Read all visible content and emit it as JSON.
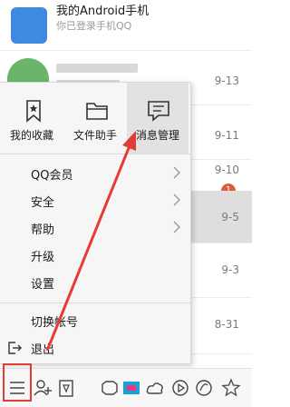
{
  "chat_list": {
    "rows": [
      {
        "title": "我的Android手机",
        "subtitle": "你已登录手机QQ",
        "date": ""
      },
      {
        "title": "",
        "subtitle": "",
        "date": "9-13"
      },
      {
        "title": "",
        "subtitle": "",
        "date": "9-11"
      },
      {
        "title": "",
        "subtitle": "",
        "date": "9-10",
        "badge": "1"
      },
      {
        "title": "",
        "subtitle": "",
        "date": "9-5"
      },
      {
        "title": "",
        "subtitle": "",
        "date": "9-3"
      },
      {
        "title": "",
        "subtitle": "",
        "date": "8-31"
      }
    ]
  },
  "popup": {
    "quick_actions": [
      {
        "label": "我的收藏",
        "icon": "bookmark-icon"
      },
      {
        "label": "文件助手",
        "icon": "folder-icon"
      },
      {
        "label": "消息管理",
        "icon": "message-icon"
      }
    ],
    "menu_items": [
      {
        "label": "QQ会员",
        "has_submenu": true
      },
      {
        "label": "安全",
        "has_submenu": true
      },
      {
        "label": "帮助",
        "has_submenu": true
      },
      {
        "label": "升级",
        "has_submenu": false
      },
      {
        "label": "设置",
        "has_submenu": false
      },
      {
        "label": "切换帐号",
        "has_submenu": false
      },
      {
        "label": "退出",
        "has_submenu": false,
        "icon": "logout-icon"
      }
    ]
  },
  "bottom_bar": {
    "icons": [
      "menu-icon",
      "add-contact-icon",
      "app-manager-icon",
      "game-icon",
      "qq-video-icon",
      "weather-icon",
      "music-icon",
      "browser-icon",
      "qzone-icon"
    ]
  },
  "colors": {
    "highlight": "#e23c35",
    "active_item_bg": "#e2e2e2",
    "badge": "#e25b3c"
  }
}
